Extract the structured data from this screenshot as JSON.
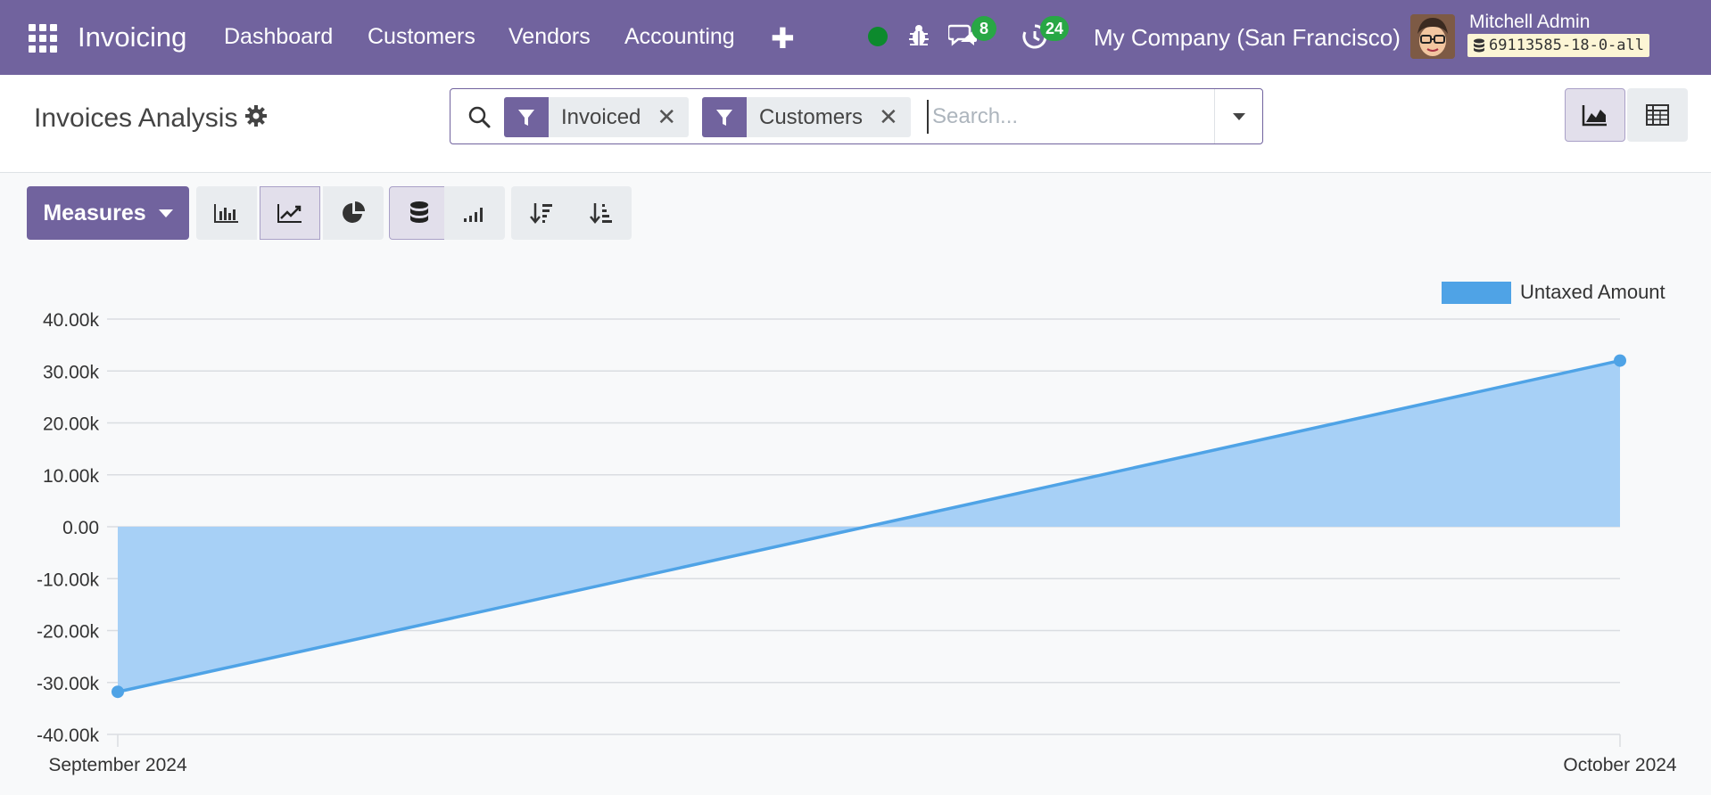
{
  "navbar": {
    "app_name": "Invoicing",
    "menu": [
      "Dashboard",
      "Customers",
      "Vendors",
      "Accounting"
    ],
    "messages_count": "8",
    "activities_count": "24",
    "company": "My Company (San Francisco)",
    "user_name": "Mitchell Admin",
    "database": "69113585-18-0-all"
  },
  "control_panel": {
    "title": "Invoices Analysis",
    "facets": [
      "Invoiced",
      "Customers"
    ],
    "search_placeholder": "Search..."
  },
  "toolbar": {
    "measures_label": "Measures"
  },
  "colors": {
    "brand": "#71639e",
    "series": "#4fa3e6",
    "series_fill": "#a7d0f6",
    "badge": "#28a745"
  },
  "chart_data": {
    "type": "area",
    "categories": [
      "September 2024",
      "October 2024"
    ],
    "series": [
      {
        "name": "Untaxed Amount",
        "values": [
          -31800,
          32000
        ]
      }
    ],
    "ylim": [
      -40000,
      40000
    ],
    "yticks": [
      "40.00k",
      "30.00k",
      "20.00k",
      "10.00k",
      "0.00",
      "-10.00k",
      "-20.00k",
      "-30.00k",
      "-40.00k"
    ],
    "grid": true,
    "legend": "top-right"
  }
}
